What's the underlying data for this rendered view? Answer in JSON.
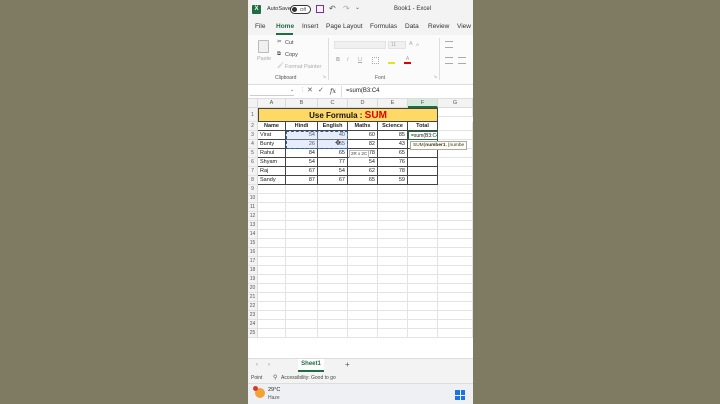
{
  "titlebar": {
    "autosave": "AutoSave",
    "toggle": "Off",
    "title": "Book1 - Excel"
  },
  "tabs": [
    "File",
    "Home",
    "Insert",
    "Page Layout",
    "Formulas",
    "Data",
    "Review",
    "View"
  ],
  "ribbon": {
    "paste": "Paste",
    "cut": "Cut",
    "copy": "Copy",
    "format_painter": "Format Painter",
    "clipboard": "Clipboard",
    "font_size": "11",
    "font_group": "Font",
    "bold": "B",
    "italic": "I",
    "underline": "U"
  },
  "formula_bar": {
    "fx": "fx",
    "formula": "=sum(B3:C4"
  },
  "columns": [
    "A",
    "B",
    "C",
    "D",
    "E",
    "F",
    "G"
  ],
  "rows": [
    "1",
    "2",
    "3",
    "4",
    "5",
    "6",
    "7",
    "8",
    "9",
    "10",
    "11",
    "12",
    "13",
    "14",
    "15",
    "16",
    "17",
    "18",
    "19",
    "20",
    "21",
    "22",
    "23",
    "24",
    "25"
  ],
  "banner": {
    "prefix": "Use Formula : ",
    "func": "SUM"
  },
  "headers": [
    "Name",
    "Hindi",
    "English",
    "Maths",
    "Science",
    "Total"
  ],
  "table": [
    {
      "name": "Virat",
      "hindi": "54",
      "english": "40",
      "maths": "60",
      "science": "85"
    },
    {
      "name": "Bunty",
      "hindi": "26",
      "english": "65",
      "maths": "82",
      "science": "43"
    },
    {
      "name": "Rahul",
      "hindi": "84",
      "english": "65",
      "maths": "78",
      "science": "65"
    },
    {
      "name": "Shyam",
      "hindi": "54",
      "english": "77",
      "maths": "54",
      "science": "76"
    },
    {
      "name": "Raj",
      "hindi": "67",
      "english": "54",
      "maths": "62",
      "science": "78"
    },
    {
      "name": "Sandy",
      "hindi": "87",
      "english": "67",
      "maths": "65",
      "science": "59"
    }
  ],
  "editing": {
    "cell_text": "=sum(B3:C4",
    "tooltip_func": "SUM(",
    "tooltip_arg1": "number1",
    "tooltip_rest": ", [numbe",
    "range_hint": "2R x 2C"
  },
  "sheet": {
    "tab": "Sheet1",
    "add": "+"
  },
  "status": {
    "mode": "Point",
    "accessibility": "Accessibility: Good to go"
  },
  "taskbar": {
    "temp": "29°C",
    "weather": "Haze"
  },
  "colors": {
    "excel_green": "#1f6e43",
    "banner_fill": "#ffd966",
    "sum_red": "#e00000",
    "background": "#7f7b63"
  }
}
